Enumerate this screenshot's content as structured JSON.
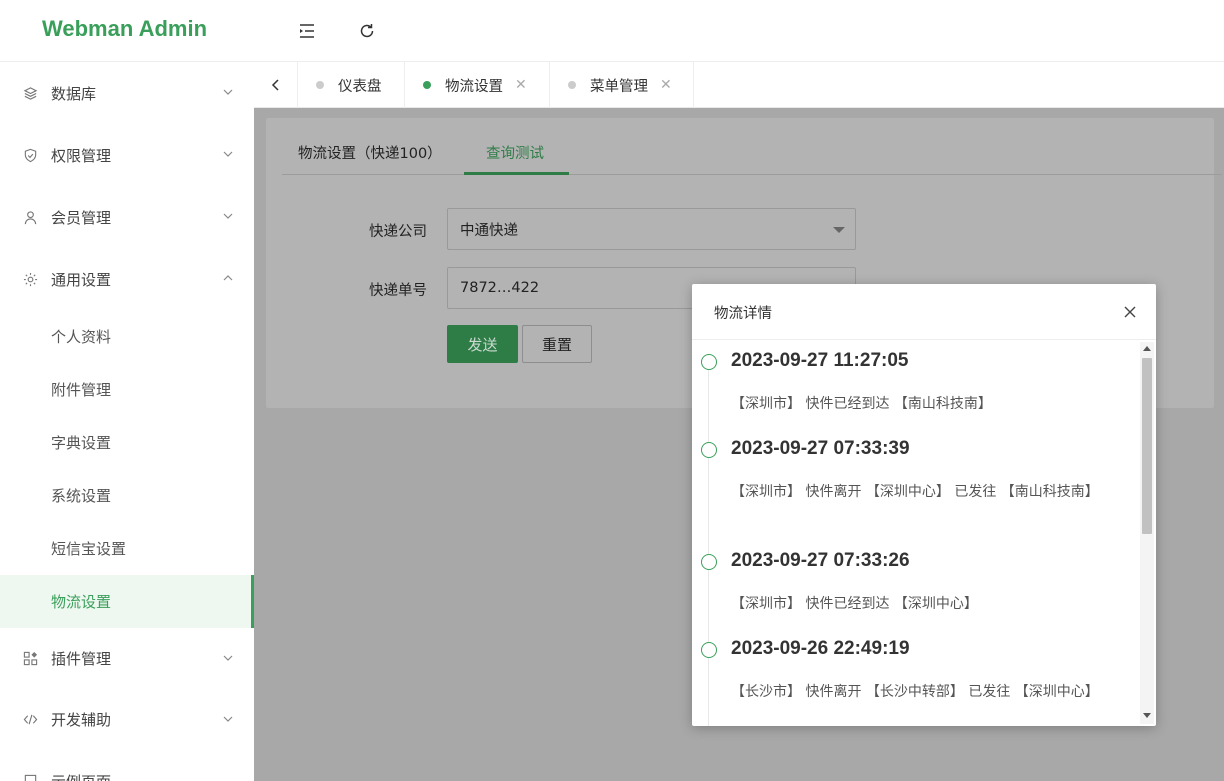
{
  "app": {
    "title": "Webman Admin"
  },
  "header": {
    "icons": [
      "menu-fold-icon",
      "refresh-icon"
    ]
  },
  "sidebar": {
    "items": [
      {
        "label": "数据库",
        "icon": "layers-icon",
        "expanded": false
      },
      {
        "label": "权限管理",
        "icon": "shield-icon",
        "expanded": false
      },
      {
        "label": "会员管理",
        "icon": "user-icon",
        "expanded": false
      },
      {
        "label": "通用设置",
        "icon": "gear-icon",
        "expanded": true
      },
      {
        "label": "插件管理",
        "icon": "apps-icon",
        "expanded": false
      },
      {
        "label": "开发辅助",
        "icon": "code-icon",
        "expanded": false
      },
      {
        "label": "示例页面",
        "icon": "page-icon",
        "expanded": false
      }
    ],
    "subitems": [
      {
        "label": "个人资料"
      },
      {
        "label": "附件管理"
      },
      {
        "label": "字典设置"
      },
      {
        "label": "系统设置"
      },
      {
        "label": "短信宝设置"
      },
      {
        "label": "物流设置",
        "active": true
      }
    ]
  },
  "tabs": [
    {
      "label": "仪表盘",
      "active": false,
      "closable": false
    },
    {
      "label": "物流设置",
      "active": true,
      "closable": true
    },
    {
      "label": "菜单管理",
      "active": false,
      "closable": true
    }
  ],
  "content": {
    "tabs": [
      {
        "label": "物流设置（快递100）",
        "active": false
      },
      {
        "label": "查询测试",
        "active": true
      }
    ],
    "form": {
      "company_label": "快递公司",
      "company_value": "中通快递",
      "number_label": "快递单号",
      "number_value": "7872…422",
      "send_label": "发送",
      "reset_label": "重置"
    }
  },
  "modal": {
    "title": "物流详情",
    "events": [
      {
        "time": "2023-09-27 11:27:05",
        "desc": "【深圳市】 快件已经到达 【南山科技南】"
      },
      {
        "time": "2023-09-27 07:33:39",
        "desc": "【深圳市】 快件离开 【深圳中心】 已发往 【南山科技南】"
      },
      {
        "time": "2023-09-27 07:33:26",
        "desc": "【深圳市】 快件已经到达 【深圳中心】"
      },
      {
        "time": "2023-09-26 22:49:19",
        "desc": "【长沙市】 快件离开 【长沙中转部】 已发往 【深圳中心】"
      }
    ]
  },
  "colors": {
    "brand": "#3a9f5b",
    "overlay": "#a8a8a8"
  }
}
